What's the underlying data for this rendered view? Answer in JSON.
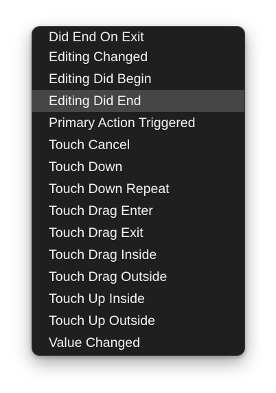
{
  "menu": {
    "items": [
      {
        "label": "Did End On Exit",
        "highlighted": false
      },
      {
        "label": "Editing Changed",
        "highlighted": false
      },
      {
        "label": "Editing Did Begin",
        "highlighted": false
      },
      {
        "label": "Editing Did End",
        "highlighted": true
      },
      {
        "label": "Primary Action Triggered",
        "highlighted": false
      },
      {
        "label": "Touch Cancel",
        "highlighted": false
      },
      {
        "label": "Touch Down",
        "highlighted": false
      },
      {
        "label": "Touch Down Repeat",
        "highlighted": false
      },
      {
        "label": "Touch Drag Enter",
        "highlighted": false
      },
      {
        "label": "Touch Drag Exit",
        "highlighted": false
      },
      {
        "label": "Touch Drag Inside",
        "highlighted": false
      },
      {
        "label": "Touch Drag Outside",
        "highlighted": false
      },
      {
        "label": "Touch Up Inside",
        "highlighted": false
      },
      {
        "label": "Touch Up Outside",
        "highlighted": false
      },
      {
        "label": "Value Changed",
        "highlighted": false
      }
    ]
  },
  "colors": {
    "menu_background": "#1f1f1f",
    "highlight": "#464646",
    "text": "#f2f2f2"
  }
}
